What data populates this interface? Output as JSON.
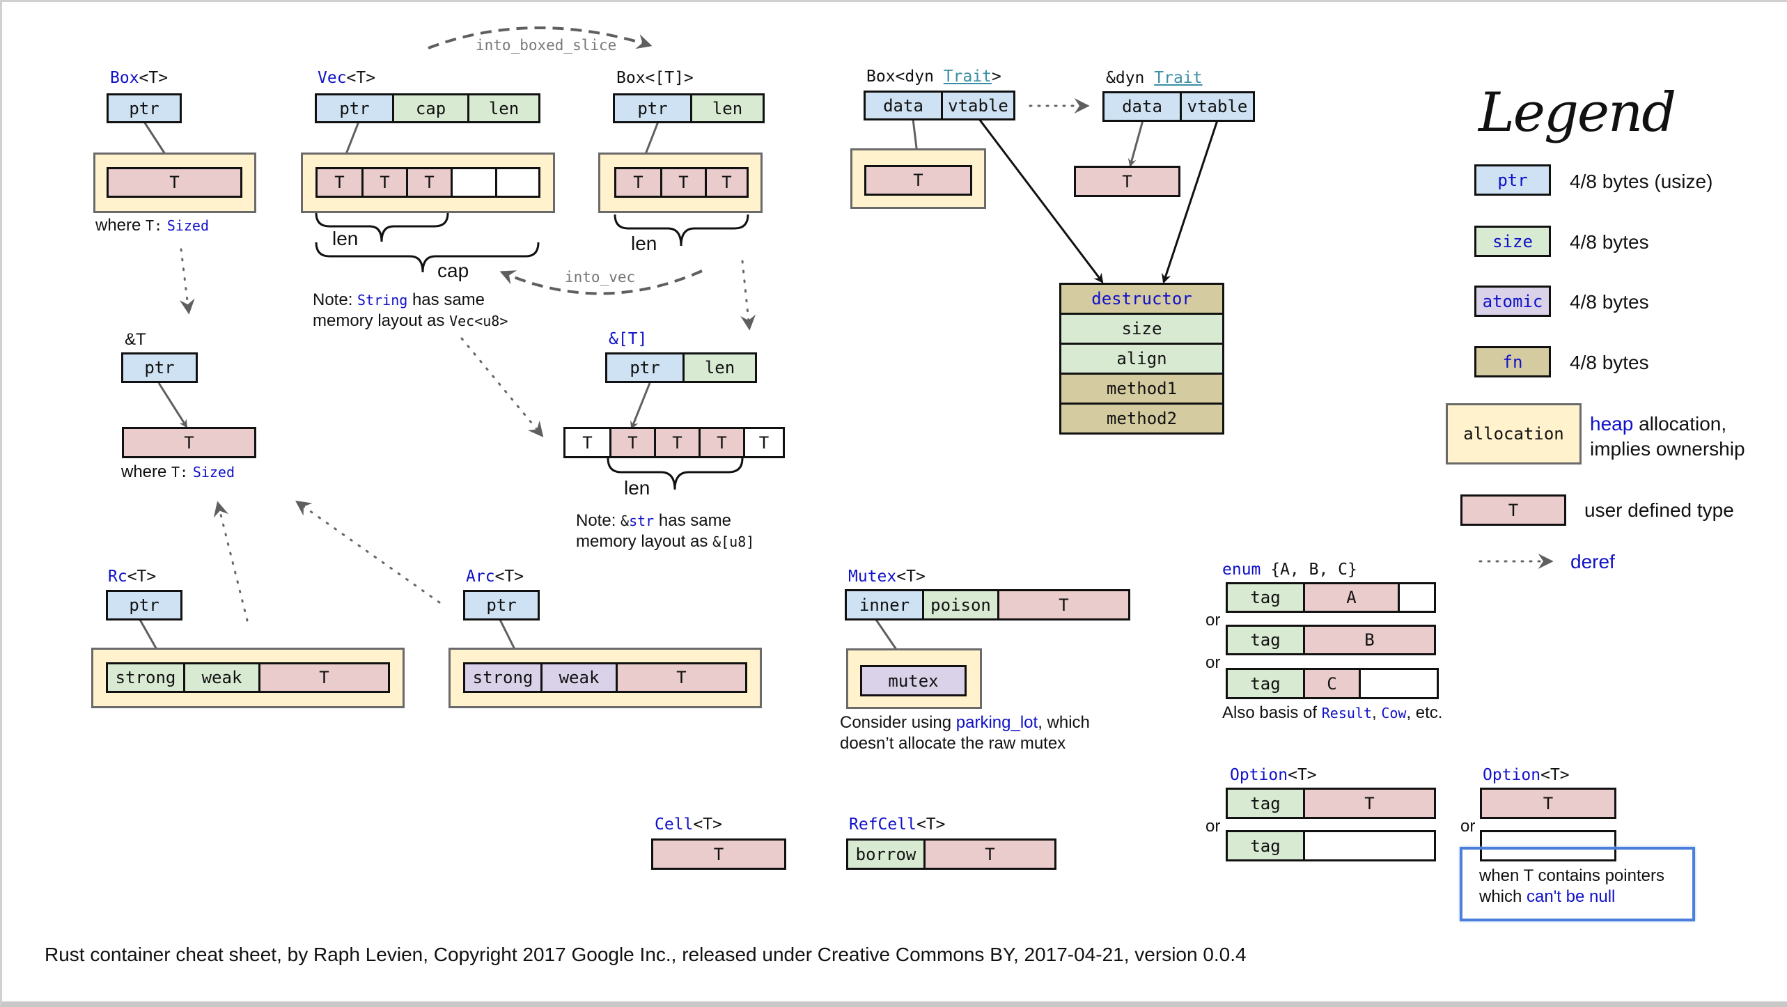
{
  "colors": {
    "ptr": "#cfe2f3",
    "size": "#d9ead3",
    "atomic": "#d9d2e9",
    "fn": "#d5cba0",
    "user_type": "#ebcccc",
    "allocation": "#fff2cc",
    "keyword": "#1010c8",
    "trait_link": "#3a8fa5",
    "highlight": "#4a7fdc"
  },
  "conversions": {
    "into_boxed_slice": "into_boxed_slice",
    "into_vec": "into_vec"
  },
  "box_t": {
    "title_kw": "Box",
    "title_rest": "<T>",
    "fields": [
      "ptr"
    ],
    "heap": [
      "T"
    ],
    "note_prefix": "where ",
    "note_t": "T:",
    "note_bound": "Sized"
  },
  "vec_t": {
    "title_kw": "Vec",
    "title_rest": "<T>",
    "fields": [
      "ptr",
      "cap",
      "len"
    ],
    "heap": [
      "T",
      "T",
      "T",
      "",
      ""
    ],
    "brace_len": "len",
    "brace_cap": "cap",
    "note_prefix": "Note: ",
    "note_kw": "String",
    "note_mid": " has same",
    "note_line2": "memory layout as ",
    "note_type": "Vec<u8>"
  },
  "box_slice": {
    "title": "Box<[T]>",
    "fields": [
      "ptr",
      "len"
    ],
    "heap": [
      "T",
      "T",
      "T"
    ],
    "brace_len": "len"
  },
  "ref_t": {
    "title": "&T",
    "fields": [
      "ptr"
    ],
    "target": [
      "T"
    ],
    "note_prefix": "where ",
    "note_t": "T:",
    "note_bound": "Sized"
  },
  "slice_ref": {
    "title": "&[T]",
    "fields": [
      "ptr",
      "len"
    ],
    "target": [
      "T",
      "T",
      "T",
      "T",
      "T"
    ],
    "brace_len": "len",
    "note_prefix": "Note: ",
    "note_amp": "&",
    "note_kw": "str",
    "note_mid": " has same",
    "note_line2": "memory layout as ",
    "note_type": "&[u8]"
  },
  "box_dyn": {
    "title_pre": "Box<dyn ",
    "title_trait": "Trait",
    "title_post": ">",
    "fields": [
      "data",
      "vtable"
    ],
    "heap": [
      "T"
    ]
  },
  "ref_dyn": {
    "title_pre": "&dyn ",
    "title_trait": "Trait",
    "fields": [
      "data",
      "vtable"
    ],
    "target": [
      "T"
    ]
  },
  "vtable": {
    "rows": [
      "destructor",
      "size",
      "align",
      "method1",
      "method2"
    ]
  },
  "rc_t": {
    "title_kw": "Rc",
    "title_rest": "<T>",
    "fields": [
      "ptr"
    ],
    "heap": [
      "strong",
      "weak",
      "T"
    ]
  },
  "arc_t": {
    "title_kw": "Arc",
    "title_rest": "<T>",
    "fields": [
      "ptr"
    ],
    "heap": [
      "strong",
      "weak",
      "T"
    ]
  },
  "mutex_t": {
    "title_kw": "Mutex",
    "title_rest": "<T>",
    "fields": [
      "inner",
      "poison",
      "T"
    ],
    "heap": [
      "mutex"
    ],
    "note_line1_pre": "Consider using ",
    "note_link": "parking_lot",
    "note_line1_post": ", which",
    "note_line2": "doesn’t allocate the raw mutex"
  },
  "enum_abc": {
    "title_kw": "enum",
    "title_rest": " {A, B, C}",
    "variants": [
      [
        "tag",
        "A",
        ""
      ],
      [
        "tag",
        "B"
      ],
      [
        "tag",
        "C",
        ""
      ]
    ],
    "or": "or",
    "note_pre": "Also basis of ",
    "note_result": "Result",
    "note_sep": ", ",
    "note_cow": "Cow",
    "note_post": ", etc."
  },
  "option_tagged": {
    "title_kw": "Option",
    "title_rest": "<T>",
    "some": [
      "tag",
      "T"
    ],
    "none": [
      "tag",
      ""
    ],
    "or": "or"
  },
  "option_niche": {
    "title_kw": "Option",
    "title_rest": "<T>",
    "some": [
      "T"
    ],
    "none": [
      ""
    ],
    "or": "or",
    "note_line1": "when T contains pointers",
    "note_line2_pre": "which ",
    "note_line2_kw": "can't be null"
  },
  "cell_t": {
    "title_kw": "Cell",
    "title_rest": "<T>",
    "fields": [
      "T"
    ]
  },
  "refcell_t": {
    "title_kw": "RefCell",
    "title_rest": "<T>",
    "fields": [
      "borrow",
      "T"
    ]
  },
  "legend": {
    "title": "Legend",
    "items": [
      {
        "key": "ptr",
        "desc": "4/8 bytes (usize)"
      },
      {
        "key": "size",
        "desc": "4/8 bytes"
      },
      {
        "key": "atomic",
        "desc": "4/8 bytes"
      },
      {
        "key": "fn",
        "desc": "4/8 bytes"
      },
      {
        "key": "allocation",
        "desc_kw": "heap",
        "desc_rest": " allocation,",
        "desc_line2": "implies ownership"
      },
      {
        "key": "T",
        "desc": "user defined type"
      },
      {
        "key": "deref-arrow",
        "desc": "deref"
      }
    ]
  },
  "footer": {
    "text": "Rust container cheat sheet, by Raph Levien, Copyright 2017 Google Inc., released under Creative Commons BY, 2017-04-21, version 0.0.4"
  }
}
